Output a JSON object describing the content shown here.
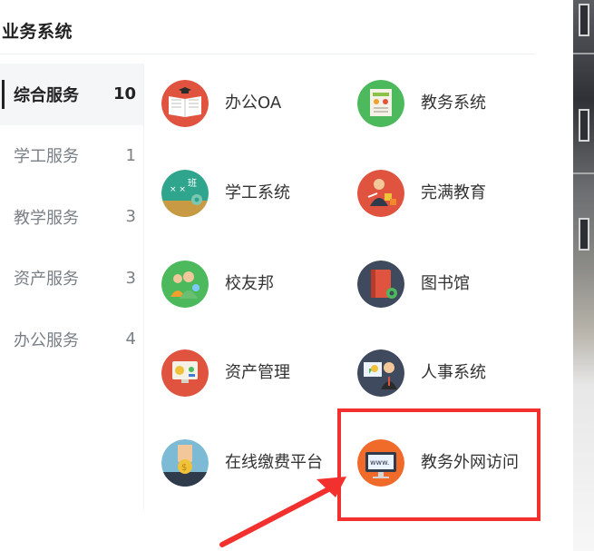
{
  "header": {
    "title": "业务系统"
  },
  "sidebar": {
    "items": [
      {
        "label": "综合服务",
        "count": "10"
      },
      {
        "label": "学工服务",
        "count": "1"
      },
      {
        "label": "教学服务",
        "count": "3"
      },
      {
        "label": "资产服务",
        "count": "3"
      },
      {
        "label": "办公服务",
        "count": "4"
      }
    ]
  },
  "apps": [
    {
      "label": "办公OA",
      "icon": "book-icon",
      "color": "#e0533f"
    },
    {
      "label": "教务系统",
      "icon": "certificate-icon",
      "color": "#4cb95c"
    },
    {
      "label": "学工系统",
      "icon": "chalkboard-icon",
      "color": "#2fa58e"
    },
    {
      "label": "完满教育",
      "icon": "teacher-icon",
      "color": "#e0533f"
    },
    {
      "label": "校友邦",
      "icon": "people-icon",
      "color": "#4cb95c"
    },
    {
      "label": "图书馆",
      "icon": "library-book-icon",
      "color": "#3f4a5e"
    },
    {
      "label": "资产管理",
      "icon": "asset-monitor-icon",
      "color": "#e0533f"
    },
    {
      "label": "人事系统",
      "icon": "presenter-icon",
      "color": "#3f4a5e"
    },
    {
      "label": "在线缴费平台",
      "icon": "coin-payment-icon",
      "color": "#7cbad6"
    },
    {
      "label": "教务外网访问",
      "icon": "www-monitor-icon",
      "color": "#f06a2a"
    }
  ]
}
